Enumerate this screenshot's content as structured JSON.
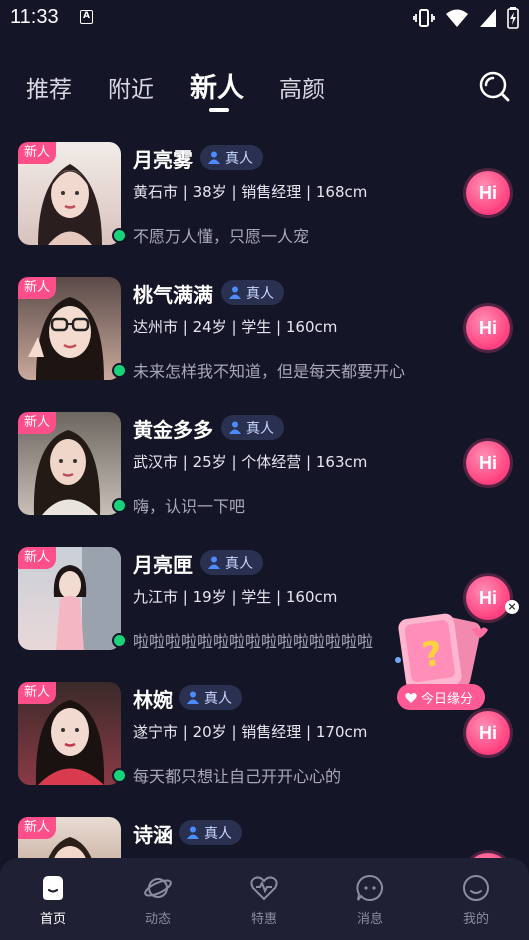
{
  "status_bar": {
    "time": "11:33",
    "badge": "A"
  },
  "tabs": [
    {
      "label": "推荐"
    },
    {
      "label": "附近"
    },
    {
      "label": "新人"
    },
    {
      "label": "高颜"
    }
  ],
  "active_tab": "新人",
  "search": {
    "icon": "search-icon"
  },
  "verified_label": "真人",
  "new_label": "新人",
  "hi_label": "Hi",
  "profiles": [
    {
      "name": "月亮雾",
      "info": "黄石市 | 38岁 | 销售经理 | 168cm",
      "bio": "不愿万人懂，只愿一人宠",
      "avatar_color": "#d8c2bd"
    },
    {
      "name": "桃气满满",
      "info": "达州市 | 24岁 | 学生 | 160cm",
      "bio": "未来怎样我不知道，但是每天都要开心",
      "avatar_color": "#c9a99a"
    },
    {
      "name": "黄金多多",
      "info": "武汉市 | 25岁 | 个体经营 | 163cm",
      "bio": "嗨，认识一下吧",
      "avatar_color": "#b5ada5"
    },
    {
      "name": "月亮匣",
      "info": "九江市 | 19岁 | 学生 | 160cm",
      "bio": "啦啦啦啦啦啦啦啦啦啦啦啦啦啦啦",
      "avatar_color": "#e0c6c8"
    },
    {
      "name": "林婉",
      "info": "遂宁市 | 20岁 | 销售经理 | 170cm",
      "bio": "每天都只想让自己开开心心的",
      "avatar_color": "#c94a5a"
    },
    {
      "name": "诗涵",
      "info": "",
      "bio": "",
      "avatar_color": "#b08878"
    }
  ],
  "fate_widget": {
    "label": "今日缘分",
    "close": "×"
  },
  "bottom_nav": [
    {
      "label": "首页",
      "icon": "home-icon"
    },
    {
      "label": "动态",
      "icon": "planet-icon"
    },
    {
      "label": "特惠",
      "icon": "heart-pulse-icon"
    },
    {
      "label": "消息",
      "icon": "message-icon"
    },
    {
      "label": "我的",
      "icon": "profile-icon"
    }
  ],
  "colors": {
    "background": "#151528",
    "accent_pink": "#ff4f8b",
    "online": "#19d37a",
    "verified_bg": "#2a3050"
  }
}
